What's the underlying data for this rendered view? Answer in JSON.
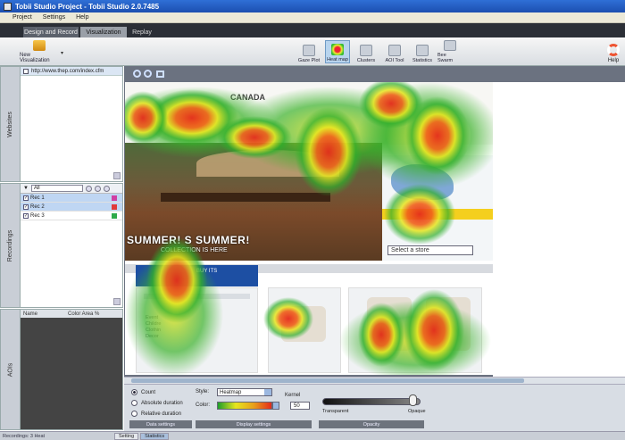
{
  "window": {
    "title": "Tobii Studio Project - Tobii Studio 2.0.7485"
  },
  "menu": [
    "Project",
    "Settings",
    "Help"
  ],
  "tabs": [
    "Design and Record",
    "Visualization",
    "Replay"
  ],
  "toolbar": {
    "new_vis": "New Visualization",
    "buttons": [
      "Gaze Plot",
      "Heat map",
      "Clusters",
      "AOI Tool",
      "Statistics",
      "Bee Swarm"
    ],
    "help": "Help"
  },
  "panels": {
    "web": {
      "side": "Websites",
      "url": "http://www.thep.com/index.cfm"
    },
    "rec": {
      "side": "Recordings",
      "filter": "All",
      "rows": [
        {
          "name": "Rec 1",
          "color": "#d03fa2"
        },
        {
          "name": "Rec 2",
          "color": "#e03a3a"
        },
        {
          "name": "Rec 3",
          "color": "#2faa4a"
        }
      ]
    },
    "aoi": {
      "side": "AOIs",
      "col_name": "Name",
      "col_color": "Color  Area %"
    }
  },
  "site": {
    "brand": "CANADA",
    "banner": "SUMMER! S SUMMER!",
    "banner_sub": "COLLECTION IS HERE",
    "store": "Select a store",
    "lower_head": "BUY ITS",
    "lower_lines": [
      "Event",
      "Childre",
      "Clothin",
      "Decor"
    ]
  },
  "settings": {
    "radios": [
      "Count",
      "Absolute duration",
      "Relative duration"
    ],
    "style_label": "Style:",
    "style_value": "Heatmap",
    "color_label": "Color:",
    "metric_label": "Kernel",
    "metric_value": "50",
    "transparent": "Transparent",
    "opaque": "Opaque",
    "sections": [
      "Data settings",
      "Display settings",
      "Opacity"
    ]
  },
  "status": {
    "left": "Recordings: 3  Heat",
    "tabs": [
      "Setting",
      "Statistics"
    ]
  },
  "colors": {
    "accent": "#1d4fa3",
    "heat_hot": "#e52b1b",
    "heat_mid": "#e7e61f",
    "heat_cool": "#1e9e2a"
  }
}
